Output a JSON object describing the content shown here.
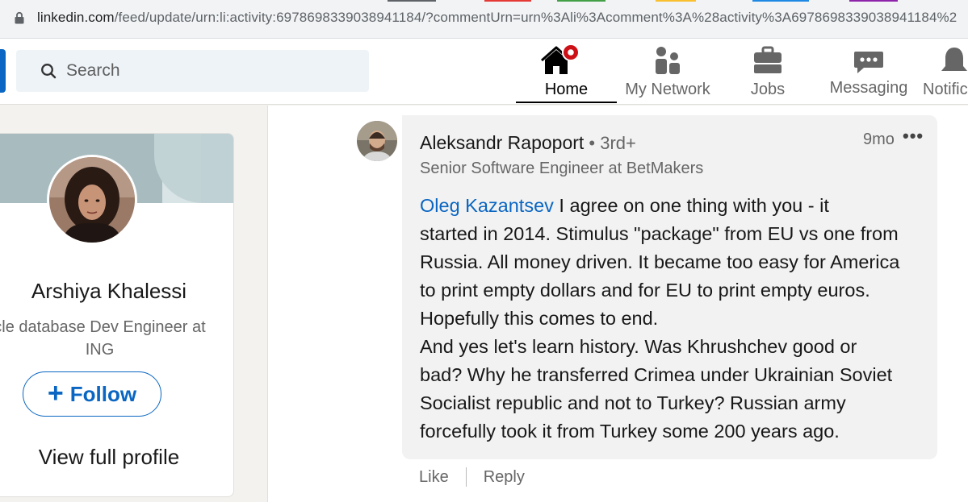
{
  "browser": {
    "url_host": "linkedin.com",
    "url_path": "/feed/update/urn:li:activity:6978698339038941184/?commentUrn=urn%3Ali%3Acomment%3A%28activity%3A6978698339038941184%2"
  },
  "search": {
    "placeholder": "Search"
  },
  "nav": {
    "home": "Home",
    "network": "My Network",
    "jobs": "Jobs",
    "messaging": "Messaging",
    "notifications": "Notific"
  },
  "profile": {
    "name": "Arshiya Khalessi",
    "headline": "cle database Dev Engineer at ING",
    "follow_label": "Follow",
    "view_full_profile": "View full profile"
  },
  "comment": {
    "author": "Aleksandr Rapoport",
    "degree": " • 3rd+",
    "headline": "Senior Software Engineer at BetMakers",
    "time": "9mo",
    "more": "•••",
    "mention": "Oleg Kazantsev",
    "lines": [
      " I agree on one thing with you - it",
      "started in 2014. Stimulus \"package\" from EU vs one from",
      "Russia. All money driven. It became too easy for America",
      "to print empty dollars and for EU to print empty euros.",
      "Hopefully this comes to end.",
      "And yes let's learn history. Was Khrushchev good or",
      "bad? Why he transferred Crimea under Ukrainian Soviet",
      "Socialist republic and not to Turkey? Russian army",
      "forcefully took it from Turkey some 200 years ago."
    ],
    "like_label": "Like",
    "reply_label": "Reply"
  },
  "colors": {
    "brand_blue": "#0a66c2",
    "notification_red": "#cc1016",
    "page_bg": "#f3f2ef",
    "bubble_bg": "#f2f2f2"
  }
}
